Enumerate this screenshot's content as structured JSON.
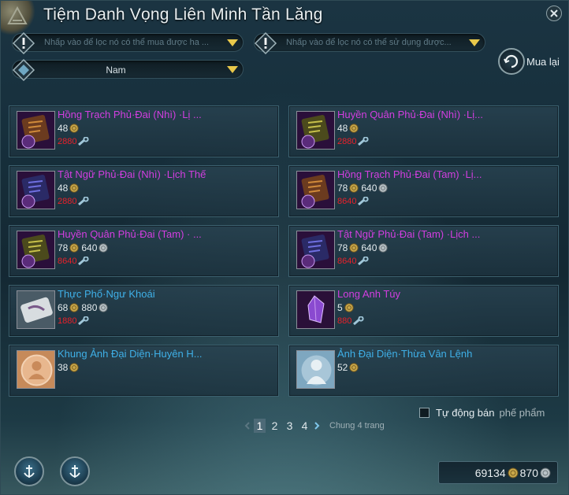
{
  "window": {
    "title": "Tiệm Danh Vọng Liên Minh Tần Lăng"
  },
  "filters": {
    "buy_placeholder": "Nhấp vào để lọc nó có thể  mua được ha ...",
    "use_placeholder": "Nhấp vào để lọc nó có thể sử dụng được...",
    "gender_value": "Nam"
  },
  "rebuy": {
    "label": "Mua lại"
  },
  "items": [
    {
      "name": "Hồng Trạch Phủ·Đai (Nhì) ·Lị ...",
      "gold": "48",
      "silver": "",
      "rep": "2880",
      "color": "purple",
      "icon": "scroll-orange-icon"
    },
    {
      "name": "Huyền Quân Phủ·Đai (Nhì) ·Lị...",
      "gold": "48",
      "silver": "",
      "rep": "2880",
      "color": "purple",
      "icon": "scroll-yellow-icon"
    },
    {
      "name": "Tật Ngữ Phủ·Đai (Nhì) ·Lịch Thế",
      "gold": "48",
      "silver": "",
      "rep": "2880",
      "color": "purple",
      "icon": "scroll-blue-icon"
    },
    {
      "name": "Hồng Trạch Phủ·Đai (Tam) ·Lị...",
      "gold": "78",
      "silver": "640",
      "rep": "8640",
      "color": "purple",
      "icon": "scroll-orange-icon"
    },
    {
      "name": "Huyền Quân Phủ·Đai (Tam) · ...",
      "gold": "78",
      "silver": "640",
      "rep": "8640",
      "color": "purple",
      "icon": "scroll-yellow-icon"
    },
    {
      "name": "Tật Ngữ Phủ·Đai (Tam) ·Lịch ...",
      "gold": "78",
      "silver": "640",
      "rep": "8640",
      "color": "purple",
      "icon": "scroll-blue-icon"
    },
    {
      "name": "Thực Phổ·Ngư Khoái",
      "gold": "68",
      "silver": "880",
      "rep": "1880",
      "color": "blue",
      "icon": "recipe-scroll-icon"
    },
    {
      "name": "Long Anh Túy",
      "gold": "5",
      "silver": "",
      "rep": "880",
      "color": "purple",
      "icon": "purple-crystal-icon"
    },
    {
      "name": "Khung Ảnh Đại Diện·Huyên H...",
      "gold": "38",
      "silver": "",
      "rep": "",
      "color": "blue",
      "icon": "avatar-frame-icon"
    },
    {
      "name": "Ảnh Đại Diện·Thừa Vân Lệnh",
      "gold": "52",
      "silver": "",
      "rep": "",
      "color": "blue",
      "icon": "avatar-portrait-icon"
    }
  ],
  "auto_sell": {
    "label": "Tự động bán",
    "sub": "phế phẩm"
  },
  "pagination": {
    "pages": [
      "1",
      "2",
      "3",
      "4"
    ],
    "current": "1",
    "total_text": "Chung 4 trang"
  },
  "wallet": {
    "gold": "69134",
    "silver": "870"
  },
  "colors": {
    "purple_name": "#d23ee0",
    "blue_name": "#3fb0e8",
    "rep_red": "#e8202a",
    "coin_gold": "#c9a84a"
  }
}
